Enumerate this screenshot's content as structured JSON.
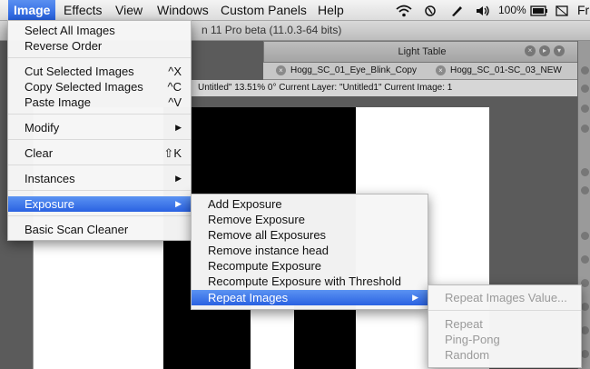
{
  "menubar": {
    "items": [
      "Image",
      "Effects",
      "View",
      "Windows",
      "Custom Panels",
      "Help"
    ],
    "battery": "100%",
    "trailing": "Fr"
  },
  "window": {
    "title_fragment": "n 11 Pro beta (11.0.3-64 bits)"
  },
  "light_table": {
    "title": "Light Table",
    "tabs": [
      "Hogg_SC_01_Eye_Blink_Copy",
      "Hogg_SC_01-SC_03_NEW"
    ]
  },
  "info_bar": "Untitled\"  13.51%   0°  Current Layer: \"Untitled1\"  Current Image: 1",
  "image_menu": {
    "items": [
      {
        "label": "Select All Images"
      },
      {
        "label": "Reverse Order"
      },
      {
        "label": "Cut Selected Images",
        "shortcut": "^X"
      },
      {
        "label": "Copy Selected Images",
        "shortcut": "^C"
      },
      {
        "label": "Paste Image",
        "shortcut": "^V"
      },
      {
        "label": "Modify"
      },
      {
        "label": "Clear",
        "shortcut": "⇧K"
      },
      {
        "label": "Instances"
      },
      {
        "label": "Exposure"
      },
      {
        "label": "Basic Scan Cleaner"
      }
    ]
  },
  "exposure_menu": {
    "items": [
      "Add Exposure",
      "Remove Exposure",
      "Remove all Exposures",
      "Remove instance head",
      "Recompute Exposure",
      "Recompute Exposure with Threshold",
      "Repeat Images"
    ]
  },
  "repeat_menu": {
    "items": [
      "Repeat Images Value...",
      "Repeat",
      "Ping-Pong",
      "Random"
    ]
  },
  "colors": {
    "highlight": "#2a62e2",
    "disabled_text": "#9a9a9a"
  }
}
